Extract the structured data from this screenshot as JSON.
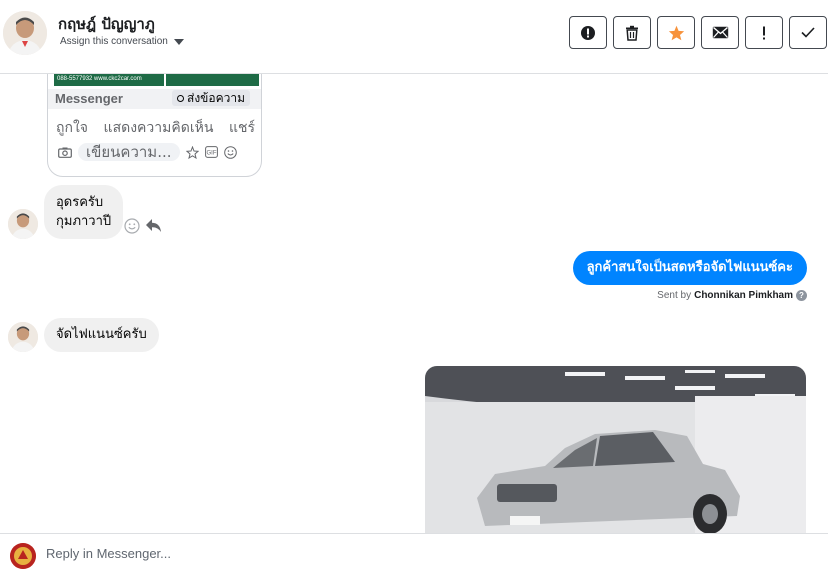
{
  "header": {
    "contact_name": "กฤษฎ์ ปัญญาภู",
    "assign_label": "Assign this conversation",
    "actions": [
      {
        "name": "mark-spam-icon",
        "label": "!"
      },
      {
        "name": "trash-icon",
        "label": ""
      },
      {
        "name": "star-icon",
        "label": ""
      },
      {
        "name": "envelope-icon",
        "label": ""
      },
      {
        "name": "follow-up-icon",
        "label": "!"
      },
      {
        "name": "checkmark-icon",
        "label": ""
      }
    ],
    "colors": {
      "star": "#f7923b"
    }
  },
  "thread": {
    "shared_post": {
      "phone_text": "088-5577932 www.ckc2car.com",
      "messenger_label": "Messenger",
      "send_message_label": "ส่งข้อความ",
      "like_label": "ถูกใจ",
      "comment_label": "แสดงความคิดเห็น",
      "share_label": "แชร์",
      "write_placeholder": "เขียนความ..."
    },
    "messages": [
      {
        "direction": "incoming",
        "lines": [
          "อุดรครับ",
          "กุมภาวาปี"
        ]
      },
      {
        "direction": "outgoing",
        "text": "ลูกค้าสนใจเป็นสดหรือจัดไฟแนนซ์คะ",
        "sent_by_prefix": "Sent by",
        "sent_by_name": "Chonnikan Pimkham"
      },
      {
        "direction": "incoming",
        "text": "จัดไฟแนนซ์ครับ"
      },
      {
        "direction": "outgoing",
        "type": "image",
        "image_description": "silver pickup truck photo"
      }
    ],
    "colors": {
      "outgoing_bubble": "#0084ff",
      "incoming_bubble": "#f0f0f0"
    }
  },
  "reply": {
    "placeholder": "Reply in Messenger..."
  }
}
